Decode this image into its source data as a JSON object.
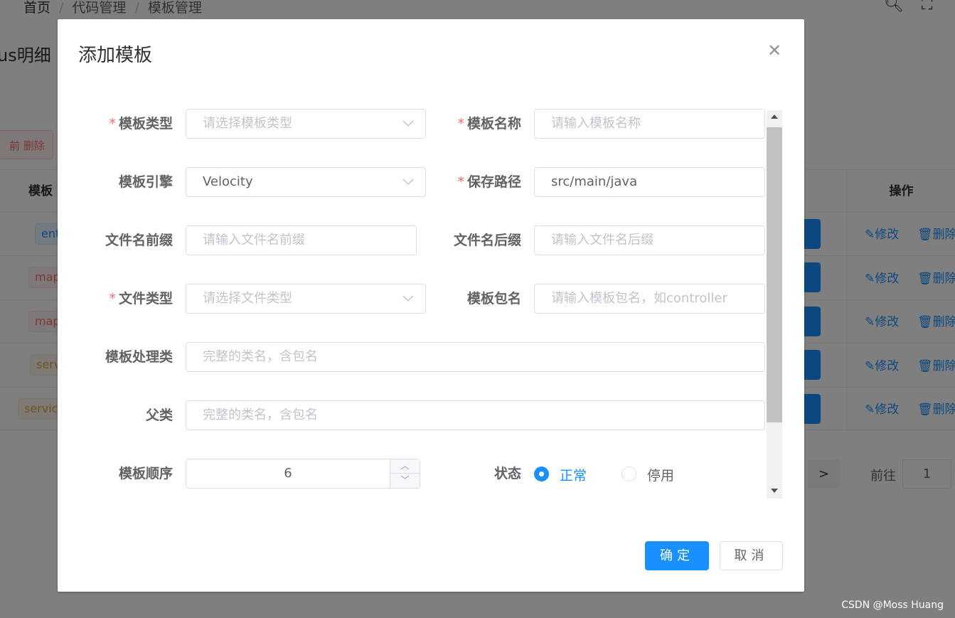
{
  "background": {
    "breadcrumb": [
      "首页",
      "代码管理",
      "模板管理"
    ],
    "page_title": "us明细",
    "delete_button": "前 删除",
    "table": {
      "headers": {
        "type": "模板",
        "actions": "操作"
      },
      "rows": [
        {
          "tag": "ent",
          "tag_color": "blue"
        },
        {
          "tag": "map",
          "tag_color": "red"
        },
        {
          "tag": "map",
          "tag_color": "red"
        },
        {
          "tag": "serv",
          "tag_color": "yellow"
        },
        {
          "tag": "servic",
          "tag_color": "yellow"
        }
      ],
      "edit_label": "修改",
      "delete_label": "删除"
    },
    "pagination": {
      "next": ">",
      "goto_label": "前往",
      "page": "1"
    }
  },
  "dialog": {
    "title": "添加模板",
    "fields": {
      "template_type": {
        "label": "模板类型",
        "required": true,
        "placeholder": "请选择模板类型"
      },
      "template_name": {
        "label": "模板名称",
        "required": true,
        "placeholder": "请输入模板名称"
      },
      "template_engine": {
        "label": "模板引擎",
        "value": "Velocity"
      },
      "save_path": {
        "label": "保存路径",
        "required": true,
        "value": "src/main/java"
      },
      "file_prefix": {
        "label": "文件名前缀",
        "placeholder": "请输入文件名前缀"
      },
      "file_suffix": {
        "label": "文件名后缀",
        "placeholder": "请输入文件名后缀"
      },
      "file_type": {
        "label": "文件类型",
        "required": true,
        "placeholder": "请选择文件类型"
      },
      "package_name": {
        "label": "模板包名",
        "placeholder": "请输入模板包名，如controller"
      },
      "handler_class": {
        "label": "模板处理类",
        "placeholder": "完整的类名，含包名"
      },
      "parent_class": {
        "label": "父类",
        "placeholder": "完整的类名，含包名"
      },
      "order": {
        "label": "模板顺序",
        "value": "6"
      },
      "status": {
        "label": "状态",
        "options": [
          "正常",
          "停用"
        ],
        "selected": "正常"
      }
    },
    "confirm": "确定",
    "cancel": "取消"
  },
  "watermark": "CSDN @Moss Huang",
  "colors": {
    "primary": "#1890ff",
    "danger": "#f56c6c"
  }
}
